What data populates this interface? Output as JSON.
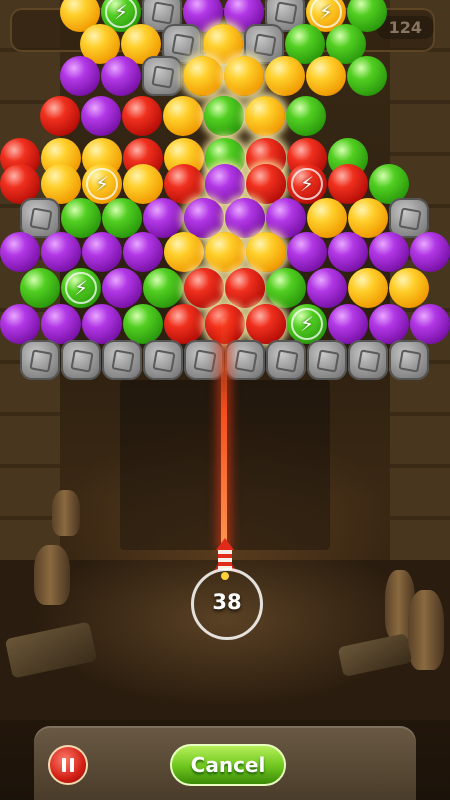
{
  "hud": {
    "score_value": "124"
  },
  "shooter": {
    "shots_left": "38"
  },
  "controls": {
    "cancel_label": "Cancel"
  },
  "bubble_colors": {
    "purple": "#b238e6",
    "yellow": "#ffcf2b",
    "red": "#f0301e",
    "green": "#52cf22",
    "stone": "#9a9a9a"
  },
  "bubble_grid": [
    [
      "yellow",
      "green-bolt",
      "stone",
      "purple",
      "purple",
      "stone",
      "yellow-bolt",
      "green",
      null
    ],
    [
      "yellow",
      "yellow",
      "stone",
      "yellow",
      "stone",
      "green",
      "green",
      null
    ],
    [
      "purple",
      "purple",
      "stone",
      "yellow",
      "yellow",
      "yellow",
      "yellow",
      "green",
      null
    ],
    [
      "red",
      "purple",
      "red",
      "yellow",
      "green",
      "yellow",
      "green",
      null
    ],
    [
      "red",
      "yellow",
      "yellow",
      "red",
      "yellow",
      "green",
      "red",
      "red",
      "green"
    ],
    [
      "red",
      "yellow",
      "yellow-bolt",
      "yellow",
      "red",
      "purple",
      "red",
      "red-bolt",
      "red",
      "green"
    ],
    [
      "stone",
      "green",
      "green",
      "purple",
      "purple",
      "purple",
      "purple",
      "yellow",
      "yellow",
      "stone"
    ],
    [
      "purple",
      "purple",
      "purple",
      "purple",
      "yellow",
      "yellow",
      "yellow",
      "purple",
      "purple",
      "purple",
      "purple"
    ],
    [
      "green",
      "green-bolt",
      "purple",
      "green",
      "red",
      "red",
      "green",
      "purple",
      "yellow",
      "yellow"
    ],
    [
      "purple",
      "purple",
      "purple",
      "green",
      "red",
      "red",
      "red",
      "green-bolt",
      "purple",
      "purple",
      "purple"
    ],
    [
      "stone",
      "stone",
      "stone",
      "stone",
      "stone",
      "stone",
      "stone",
      "stone",
      "stone",
      "stone"
    ]
  ]
}
